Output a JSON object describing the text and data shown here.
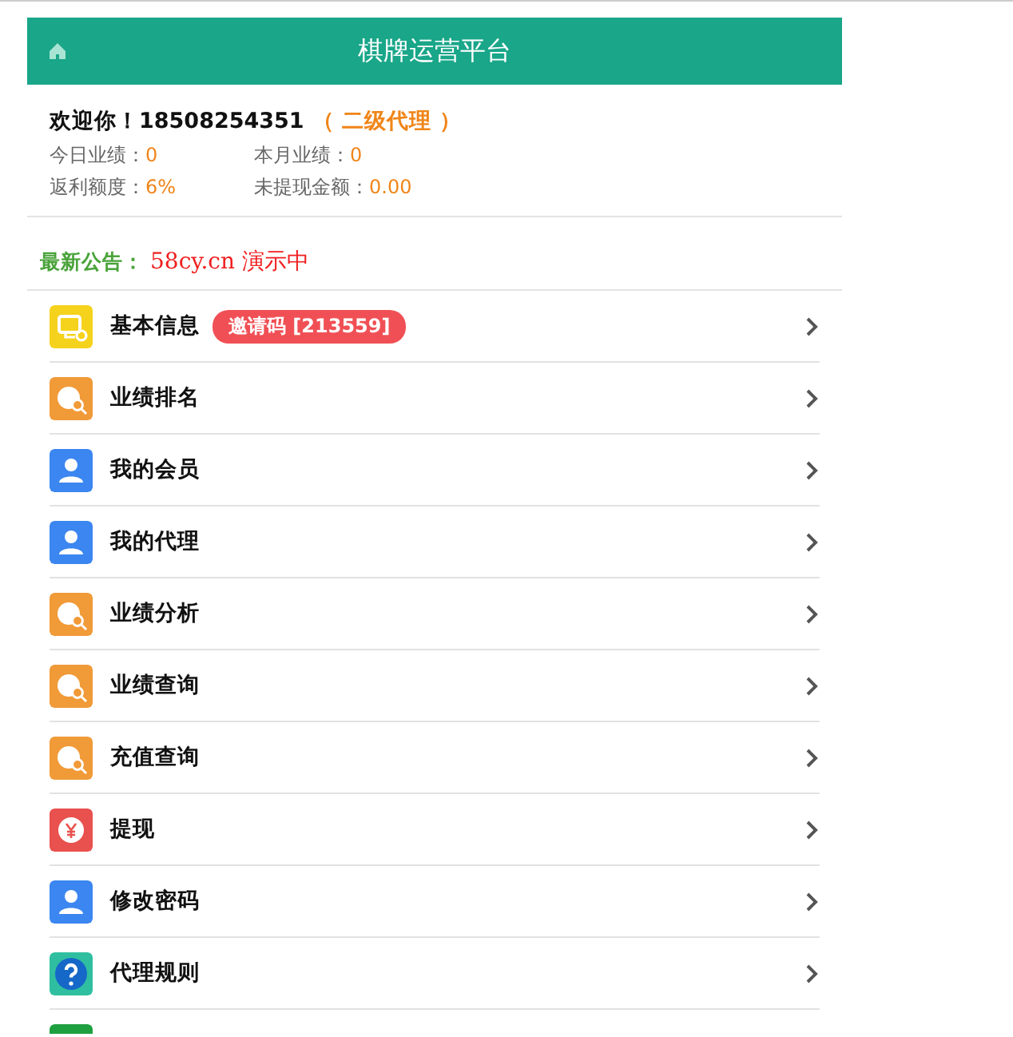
{
  "header": {
    "title": "棋牌运营平台"
  },
  "account": {
    "greeting": "欢迎你！18508254351",
    "level": "（ 二级代理 ）",
    "stats": [
      {
        "label": "今日业绩：",
        "value": "0"
      },
      {
        "label": "本月业绩：",
        "value": "0"
      },
      {
        "label": "返利额度：",
        "value": "6%"
      },
      {
        "label": "未提现金额：",
        "value": "0.00"
      }
    ]
  },
  "notice": {
    "label": "最新公告：",
    "text": "58cy.cn 演示中"
  },
  "menu": [
    {
      "kind": "monitor",
      "label": "基本信息",
      "badge": "邀请码 [213559]"
    },
    {
      "kind": "ranking",
      "label": "业绩排名"
    },
    {
      "kind": "member",
      "label": "我的会员"
    },
    {
      "kind": "member",
      "label": "我的代理"
    },
    {
      "kind": "ranking",
      "label": "业绩分析"
    },
    {
      "kind": "ranking",
      "label": "业绩查询"
    },
    {
      "kind": "ranking",
      "label": "充值查询"
    },
    {
      "kind": "withdraw",
      "label": "提现"
    },
    {
      "kind": "member",
      "label": "修改密码"
    },
    {
      "kind": "help",
      "label": "代理规则"
    },
    {
      "kind": "card"
    }
  ]
}
